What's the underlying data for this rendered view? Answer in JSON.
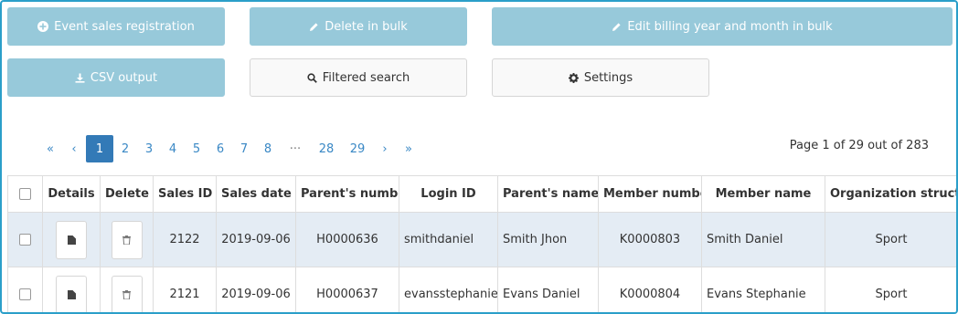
{
  "colors": {
    "border": "#2b9fc9",
    "primary_button": "#97c9da",
    "active_page": "#337ab7",
    "stripe": "#e4ecf4"
  },
  "toolbar": {
    "event_sales_registration": "Event sales registration",
    "delete_in_bulk": "Delete in bulk",
    "edit_billing_in_bulk": "Edit billing year and month in bulk",
    "csv_output": "CSV output",
    "filtered_search": "Filtered search",
    "settings": "Settings"
  },
  "pagination": {
    "first": "«",
    "prev": "‹",
    "pages": [
      "1",
      "2",
      "3",
      "4",
      "5",
      "6",
      "7",
      "8"
    ],
    "ellipsis": "···",
    "last_pages": [
      "28",
      "29"
    ],
    "next": "›",
    "last": "»",
    "current": "1",
    "info": "Page 1 of 29 out of 283"
  },
  "table": {
    "headers": [
      "Details",
      "Delete",
      "Sales ID",
      "Sales date",
      "Parent's number",
      "Login ID",
      "Parent's name",
      "Member number",
      "Member name",
      "Organization structu"
    ],
    "rows": [
      {
        "sales_id": "2122",
        "sales_date": "2019-09-06",
        "parent_number": "H0000636",
        "login_id": "smithdaniel",
        "parent_name": "Smith Jhon",
        "member_number": "K0000803",
        "member_name": "Smith Daniel",
        "organization": "Sport"
      },
      {
        "sales_id": "2121",
        "sales_date": "2019-09-06",
        "parent_number": "H0000637",
        "login_id": "evansstephanie",
        "parent_name": "Evans Daniel",
        "member_number": "K0000804",
        "member_name": "Evans Stephanie",
        "organization": "Sport"
      }
    ]
  }
}
